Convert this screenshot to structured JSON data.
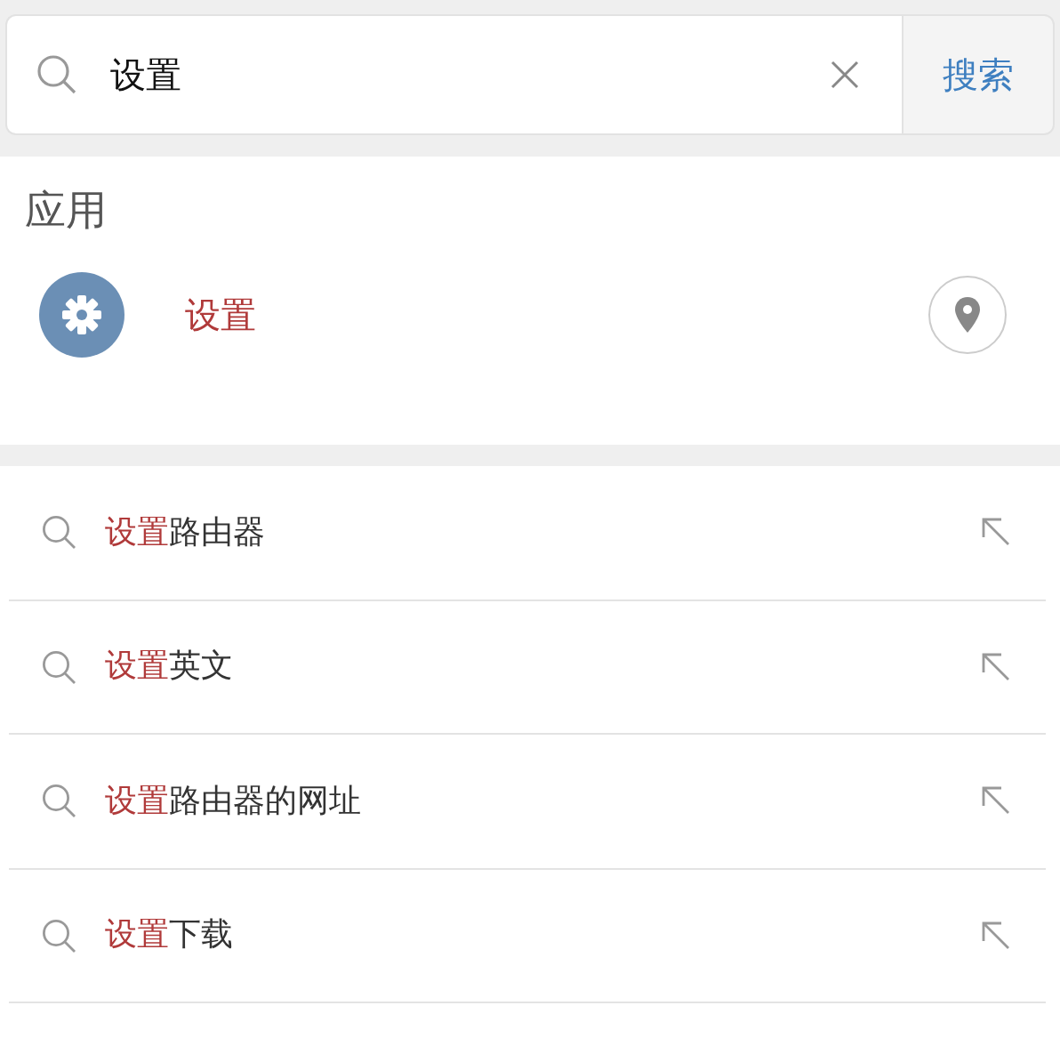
{
  "search": {
    "value": "设置",
    "button": "搜索"
  },
  "apps_section": {
    "title": "应用",
    "apps": [
      {
        "name": "设置"
      }
    ]
  },
  "suggestions": [
    {
      "match": "设置",
      "rest": "路由器"
    },
    {
      "match": "设置",
      "rest": "英文"
    },
    {
      "match": "设置",
      "rest": "路由器的网址"
    },
    {
      "match": "设置",
      "rest": "下载"
    }
  ]
}
